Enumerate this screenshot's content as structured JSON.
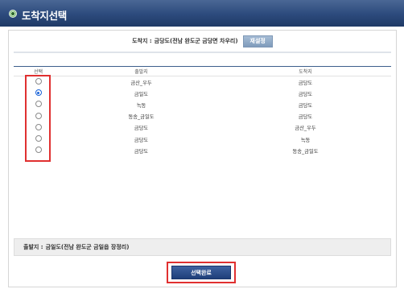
{
  "window": {
    "title": "도착지선택",
    "icon": "circle-bullet-icon"
  },
  "destination": {
    "label": "도착지 :",
    "value": "금당도(전남 완도군 금당면 차우리)",
    "reset_label": "재설정"
  },
  "table": {
    "headers": {
      "select": "선택",
      "departure": "출발지",
      "arrival": "도착지"
    },
    "rows": [
      {
        "departure": "금산_우두",
        "arrival": "금당도",
        "selected": false
      },
      {
        "departure": "금일도",
        "arrival": "금당도",
        "selected": true
      },
      {
        "departure": "녹동",
        "arrival": "금당도",
        "selected": false
      },
      {
        "departure": "동송_금일도",
        "arrival": "금당도",
        "selected": false
      },
      {
        "departure": "금당도",
        "arrival": "금산_우두",
        "selected": false
      },
      {
        "departure": "금당도",
        "arrival": "녹동",
        "selected": false
      },
      {
        "departure": "금당도",
        "arrival": "동송_금일도",
        "selected": false
      }
    ]
  },
  "departure": {
    "label": "출발지 :",
    "value": "금일도(전남 완도군 금일읍 장정리)"
  },
  "confirm_label": "선택완료",
  "colors": {
    "titlebar": "#2c4a7c",
    "highlight": "#e03030",
    "button": "#2a4b87"
  }
}
